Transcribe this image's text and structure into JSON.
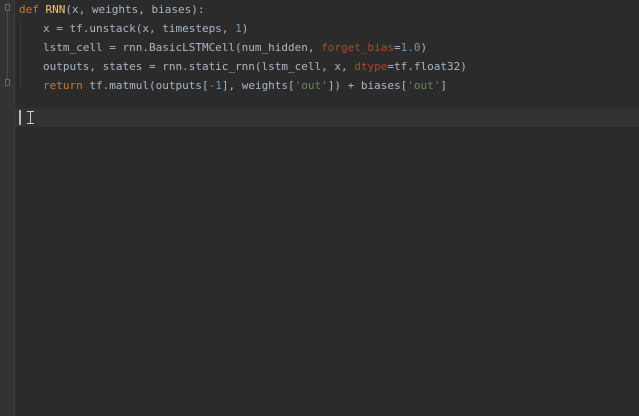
{
  "editor": {
    "language": "python",
    "lines": [
      {
        "tokens": [
          {
            "t": "def ",
            "c": "kw"
          },
          {
            "t": "RNN",
            "c": "fn"
          },
          {
            "t": "(x, weights, biases):",
            "c": "plain"
          }
        ]
      },
      {
        "indent": true,
        "tokens": [
          {
            "t": "x = tf.unstack(x, timesteps, ",
            "c": "plain"
          },
          {
            "t": "1",
            "c": "num"
          },
          {
            "t": ")",
            "c": "plain"
          }
        ]
      },
      {
        "indent": true,
        "tokens": [
          {
            "t": "lstm_cell = rnn.BasicLSTMCell(num_hidden, ",
            "c": "plain"
          },
          {
            "t": "forget_bias",
            "c": "kwarg"
          },
          {
            "t": "=",
            "c": "plain"
          },
          {
            "t": "1.0",
            "c": "num"
          },
          {
            "t": ")",
            "c": "plain"
          }
        ]
      },
      {
        "indent": true,
        "tokens": [
          {
            "t": "outputs, states = rnn.static_rnn(lstm_cell, x, ",
            "c": "plain"
          },
          {
            "t": "dtype",
            "c": "kwarg"
          },
          {
            "t": "=tf.float32)",
            "c": "plain"
          }
        ]
      },
      {
        "indent": true,
        "tokens": [
          {
            "t": "return ",
            "c": "kw"
          },
          {
            "t": "tf.matmul(outputs[",
            "c": "plain"
          },
          {
            "t": "-1",
            "c": "num"
          },
          {
            "t": "], weights[",
            "c": "plain"
          },
          {
            "t": "'out'",
            "c": "str"
          },
          {
            "t": "]) + biases[",
            "c": "plain"
          },
          {
            "t": "'out'",
            "c": "str"
          },
          {
            "t": "]",
            "c": "plain"
          }
        ]
      },
      {
        "tokens": []
      }
    ]
  },
  "colors": {
    "background": "#2b2b2b",
    "gutter": "#313335",
    "current_line": "#323232",
    "default_text": "#a9b7c6",
    "keyword": "#cc7832",
    "function_name": "#ffc66d",
    "keyword_argument": "#aa4926",
    "number": "#6897bb",
    "string": "#6a8759"
  },
  "icons": {
    "fold_marker": "fold-toggle-icon",
    "mouse_pointer": "text-ibeam-cursor-icon"
  }
}
